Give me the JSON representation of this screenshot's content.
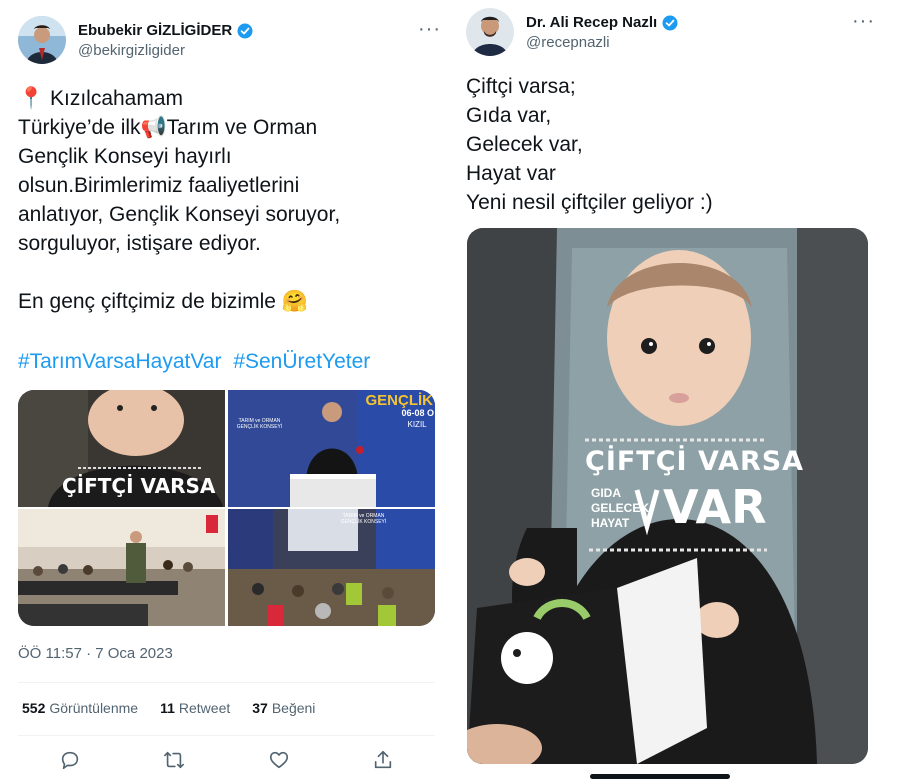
{
  "left_tweet": {
    "author": {
      "display_name": "Ebubekir GİZLİGİDER",
      "handle": "@bekirgizligider",
      "verified": true
    },
    "more_label": "···",
    "text": "📍 Kızılcahamam\nTürkiye’de ilk📢Tarım ve Orman\nGençlik Konseyi hayırlı\nolsun.Birimlerimiz faaliyetlerini\nanlatıyor, Gençlik Konseyi soruyor,\nsorguluyor, istişare ediyor.\n\nEn genç çiftçimiz de bizimle 🤗",
    "hashtags": [
      "#TarımVarsaHayatVar",
      "#SenÜretYeter"
    ],
    "media": {
      "photo1_shirt": "ÇİFTÇİ VARSA",
      "photo2_banner": "GENÇLİK",
      "photo2_dates": "06-08 O",
      "photo2_place": "KIZIL",
      "photo2_sign": "TARIM ve ORMAN GENÇLİK KONSEYİ",
      "photo4_sign": "TARIM ve ORMAN GENÇLİK KONSEYİ"
    },
    "timestamp": "ÖÖ 11:57 · 7 Oca 2023",
    "stats": [
      {
        "value": "552",
        "label": "Görüntülenme"
      },
      {
        "value": "11",
        "label": "Retweet"
      },
      {
        "value": "37",
        "label": "Beğeni"
      }
    ],
    "actions": [
      "reply-icon",
      "retweet-icon",
      "like-icon",
      "share-icon"
    ]
  },
  "right_tweet": {
    "author": {
      "display_name": "Dr. Ali Recep Nazlı",
      "handle": "@recepnazli",
      "verified": true
    },
    "more_label": "···",
    "text": "Çiftçi varsa;\nGıda var,\nGelecek var,\nHayat var\nYeni nesil çiftçiler geliyor :)",
    "photo": {
      "shirt_top": "ÇİFTÇİ VARSA",
      "shirt_words": [
        "GIDA",
        "GELECEK",
        "HAYAT"
      ],
      "shirt_big": "VAR"
    }
  },
  "colors": {
    "accent": "#1d9bf0",
    "secondary_text": "#536471",
    "primary_text": "#0f1419"
  }
}
